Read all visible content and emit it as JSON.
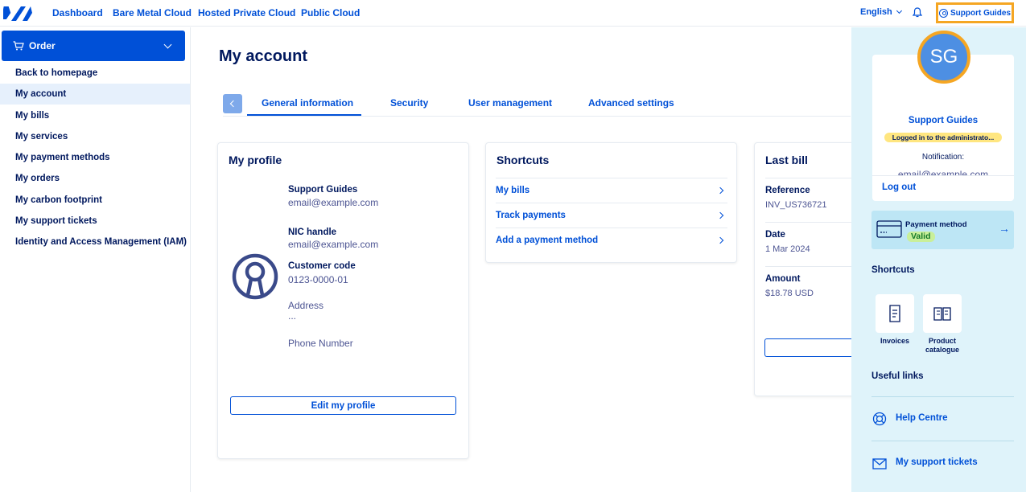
{
  "topbar": {
    "nav": [
      "Dashboard",
      "Bare Metal Cloud",
      "Hosted Private Cloud",
      "Public Cloud"
    ],
    "language": "English",
    "user_button": "Support Guides"
  },
  "sidebar": {
    "order_label": "Order",
    "items": [
      "Back to homepage",
      "My account",
      "My bills",
      "My services",
      "My payment methods",
      "My orders",
      "My carbon footprint",
      "My support tickets",
      "Identity and Access Management (IAM)"
    ],
    "active_item": "My account"
  },
  "main": {
    "title": "My account",
    "tabs": [
      "General information",
      "Security",
      "User management",
      "Advanced settings"
    ],
    "active_tab": "General information",
    "profile": {
      "title": "My profile",
      "name": "Support Guides",
      "email": "email@example.com",
      "nic_label": "NIC handle",
      "nic_value": "email@example.com",
      "customer_code_label": "Customer code",
      "customer_code_value": "0123-0000-01",
      "address_label": "Address",
      "address_value": "...",
      "phone_label": "Phone Number",
      "edit_button": "Edit my profile"
    },
    "shortcuts": {
      "title": "Shortcuts",
      "links": [
        "My bills",
        "Track payments",
        "Add a payment method"
      ]
    },
    "last_bill": {
      "title": "Last bill",
      "reference_label": "Reference",
      "reference_value": "INV_US736721",
      "date_label": "Date",
      "date_value": "1 Mar 2024",
      "amount_label": "Amount",
      "amount_value": "$18.78 USD"
    }
  },
  "user_panel": {
    "initials": "SG",
    "name": "Support Guides",
    "badge": "Logged in to the administrato...",
    "notification_label": "Notification:",
    "email": "email@example.com",
    "logout": "Log out",
    "payment_method_label": "Payment method",
    "payment_status": "Valid",
    "shortcuts_title": "Shortcuts",
    "tiles": [
      "Invoices",
      "Product catalogue"
    ],
    "useful_links_title": "Useful links",
    "links": [
      "Help Centre",
      "My support tickets"
    ],
    "colors": {
      "accent": "#0050d7",
      "highlight": "#f5a623",
      "panel_bg": "#dff3fa"
    }
  }
}
